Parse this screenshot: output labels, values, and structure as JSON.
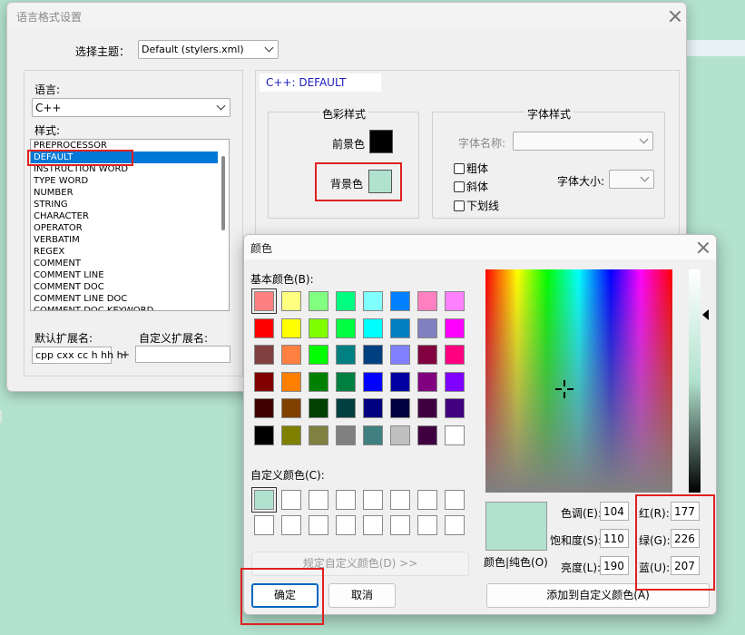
{
  "style_dialog": {
    "title": "语言格式设置",
    "theme_label": "选择主题：",
    "theme_value": "Default (stylers.xml)",
    "language_label": "语言:",
    "language_value": "C++",
    "style_label": "样式:",
    "styles": [
      "PREPROCESSOR",
      "DEFAULT",
      "INSTRUCTION WORD",
      "TYPE WORD",
      "NUMBER",
      "STRING",
      "CHARACTER",
      "OPERATOR",
      "VERBATIM",
      "REGEX",
      "COMMENT",
      "COMMENT LINE",
      "COMMENT DOC",
      "COMMENT LINE DOC",
      "COMMENT DOC KEYWORD"
    ],
    "selected_style": "DEFAULT",
    "default_ext_label": "默认扩展名:",
    "default_ext_value": "cpp cxx cc h hh h",
    "plus": "+",
    "user_ext_label": "自定义扩展名:",
    "user_ext_value": "",
    "style_header": "C++: DEFAULT",
    "color_group_title": "色彩样式",
    "fg_label": "前景色",
    "fg_color": "#000000",
    "bg_label": "背景色",
    "bg_color": "#b1e2cf",
    "font_group_title": "字体样式",
    "font_name_label": "字体名称:",
    "font_name_value": "",
    "bold_label": "粗体",
    "italic_label": "斜体",
    "underline_label": "下划线",
    "font_size_label": "字体大小:",
    "font_size_value": ""
  },
  "color_dialog": {
    "title": "颜色",
    "basic_colors_label": "基本颜色(B):",
    "basic_colors": [
      "#ff8080",
      "#ffff80",
      "#80ff80",
      "#00ff80",
      "#80ffff",
      "#0080ff",
      "#ff80c0",
      "#ff80ff",
      "#ff0000",
      "#ffff00",
      "#80ff00",
      "#00ff40",
      "#00ffff",
      "#0080c0",
      "#8080c0",
      "#ff00ff",
      "#804040",
      "#ff8040",
      "#00ff00",
      "#008080",
      "#004080",
      "#8080ff",
      "#800040",
      "#ff0080",
      "#800000",
      "#ff8000",
      "#008000",
      "#008040",
      "#0000ff",
      "#0000a0",
      "#800080",
      "#8000ff",
      "#400000",
      "#804000",
      "#004000",
      "#004040",
      "#000080",
      "#000040",
      "#400040",
      "#400080",
      "#000000",
      "#808000",
      "#808040",
      "#808080",
      "#408080",
      "#c0c0c0",
      "#400040",
      "#ffffff"
    ],
    "custom_colors_label": "自定义颜色(C):",
    "custom_colors": [
      "#b1e2cf",
      "#ffffff",
      "#ffffff",
      "#ffffff",
      "#ffffff",
      "#ffffff",
      "#ffffff",
      "#ffffff",
      "#ffffff",
      "#ffffff",
      "#ffffff",
      "#ffffff",
      "#ffffff",
      "#ffffff",
      "#ffffff",
      "#ffffff"
    ],
    "define_custom_button": "规定自定义颜色(D) >>",
    "ok_button": "确定",
    "cancel_button": "取消",
    "solid_label": "颜色|纯色(O)",
    "hue_label": "色调(E):",
    "hue_value": "104",
    "sat_label": "饱和度(S):",
    "sat_value": "110",
    "lum_label": "亮度(L):",
    "lum_value": "190",
    "red_label": "红(R):",
    "red_value": "177",
    "green_label": "绿(G):",
    "green_value": "226",
    "blue_label": "蓝(U):",
    "blue_value": "207",
    "add_custom_button": "添加到自定义颜色(A)",
    "current_color": "#b1e2cf"
  }
}
